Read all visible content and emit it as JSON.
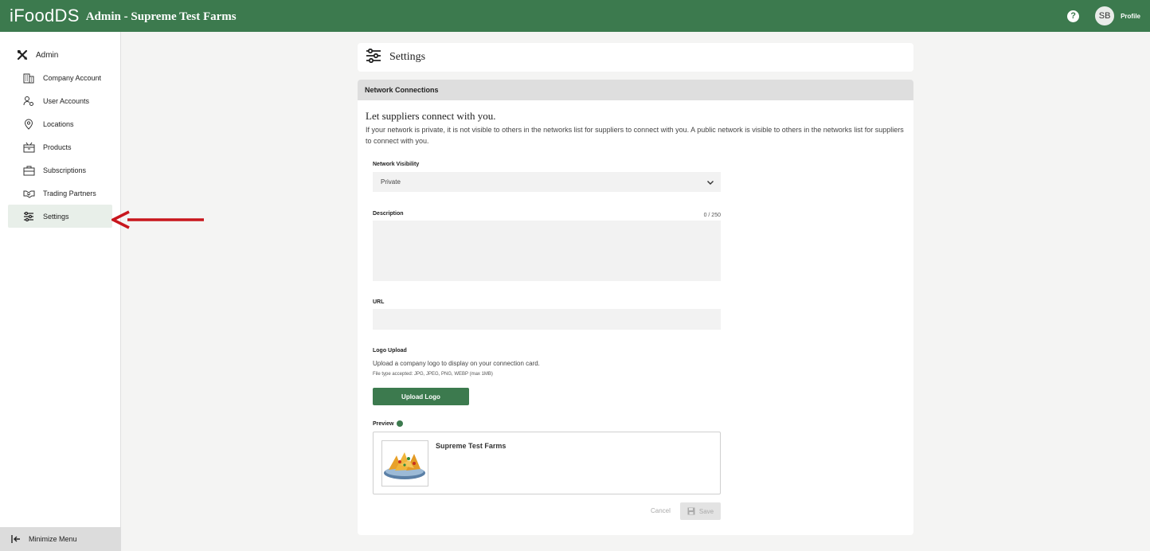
{
  "header": {
    "logo": "iFoodDS",
    "title": "Admin - Supreme Test Farms",
    "help_glyph": "?",
    "avatar_initials": "SB",
    "profile_label": "Profile",
    "color": "#3c7a4e"
  },
  "sidebar": {
    "section": "Admin",
    "items": [
      {
        "label": "Company Account",
        "icon": "building-icon"
      },
      {
        "label": "User Accounts",
        "icon": "user-gear-icon"
      },
      {
        "label": "Locations",
        "icon": "map-pin-icon"
      },
      {
        "label": "Products",
        "icon": "box-icon"
      },
      {
        "label": "Subscriptions",
        "icon": "briefcase-icon"
      },
      {
        "label": "Trading Partners",
        "icon": "handshake-icon"
      },
      {
        "label": "Settings",
        "icon": "sliders-icon",
        "active": true
      }
    ],
    "minimize_label": "Minimize Menu"
  },
  "page": {
    "title": "Settings"
  },
  "network": {
    "section_title": "Network Connections",
    "lead": "Let suppliers connect with you.",
    "lead_desc": "If your network is private, it is not visible to others in the networks list for suppliers to connect with you. A public network is visible to others in the networks list for suppliers to connect with you.",
    "visibility_label": "Network Visibility",
    "visibility_value": "Private",
    "description_label": "Description",
    "description_counter": "0 / 250",
    "url_label": "URL",
    "logo_upload_label": "Logo Upload",
    "logo_upload_desc": "Upload a company logo to display on your connection card.",
    "logo_upload_note": "File type accepted: JPG, JPEG, PNG, WEBP (max 1MB)",
    "upload_button": "Upload Logo",
    "preview_label": "Preview",
    "preview_name": "Supreme Test Farms",
    "cancel_label": "Cancel",
    "save_label": "Save"
  }
}
